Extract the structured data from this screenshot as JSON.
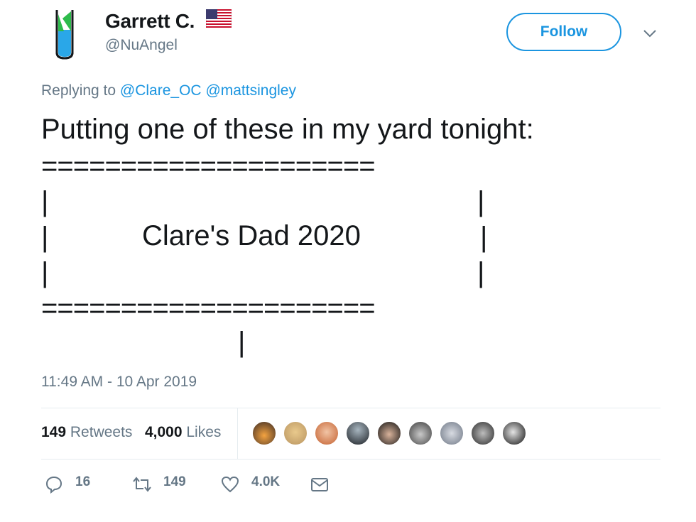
{
  "tweet": {
    "author_name": "Garrett C.",
    "author_handle": "@NuAngel",
    "follow_label": "Follow",
    "reply_prefix": "Replying to",
    "reply_to_1": "@Clare_OC",
    "reply_to_2": "@mattsingley",
    "body_line1": "Putting one of these in my yard tonight:",
    "sign_rule_top": "=====================",
    "sign_bar_left": "|",
    "sign_bar_right": "|",
    "sign_text": "Clare's Dad 2020",
    "sign_rule_bottom": "=====================",
    "sign_post": "|",
    "timestamp": "11:49 AM - 10 Apr 2019"
  },
  "stats": {
    "retweets_count": "149",
    "retweets_label": "Retweets",
    "likes_count": "4,000",
    "likes_label": "Likes"
  },
  "actions": {
    "reply_count": "16",
    "retweet_count": "149",
    "like_count": "4.0K"
  },
  "colors": {
    "accent": "#1b95e0",
    "secondary_text": "#657786",
    "divider": "#e6ecf0"
  },
  "icons": [
    "verified-flag-icon",
    "chevron-down-icon",
    "reply-icon",
    "retweet-icon",
    "like-icon",
    "message-icon"
  ]
}
